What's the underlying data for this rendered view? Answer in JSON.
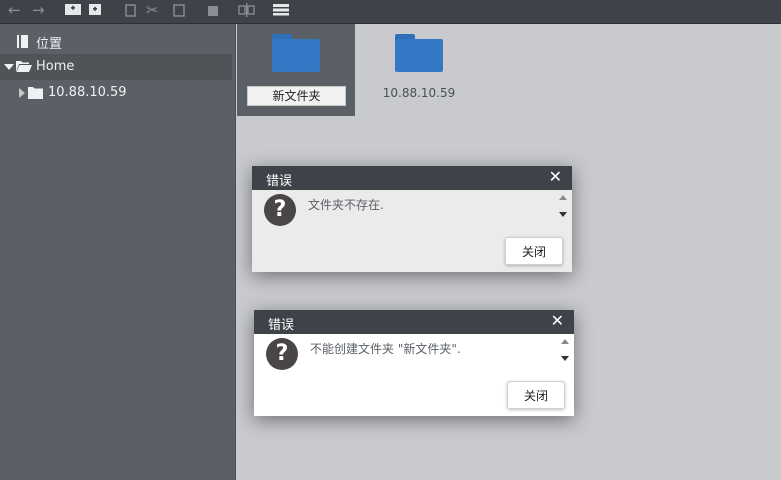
{
  "toolbar": {
    "icons": [
      "back-arrow-icon",
      "forward-arrow-icon",
      "new-folder-icon",
      "new-file-icon",
      "copy-icon",
      "cut-icon",
      "paste-icon",
      "delete-icon",
      "rename-icon",
      "view-list-icon"
    ]
  },
  "sidebar": {
    "places_label": "位置",
    "home_label": "Home",
    "server_label": "10.88.10.59"
  },
  "files": {
    "items": [
      {
        "name": "新文件夹"
      },
      {
        "name": "10.88.10.59"
      }
    ]
  },
  "dialogs": [
    {
      "title": "错误",
      "close_glyph": "✕",
      "message": "文件夹不存在.",
      "button": "关闭"
    },
    {
      "title": "错误",
      "close_glyph": "✕",
      "message": "不能创建文件夹 \"新文件夹\".",
      "button": "关闭"
    }
  ],
  "colors": {
    "toolbar": "#3e4249",
    "sidebar": "#5b6066",
    "folder": "#3479c6",
    "main_bg": "#c9cace",
    "dialog_bg_1": "#ebebeb",
    "dialog_bg_2": "#ffffff"
  }
}
